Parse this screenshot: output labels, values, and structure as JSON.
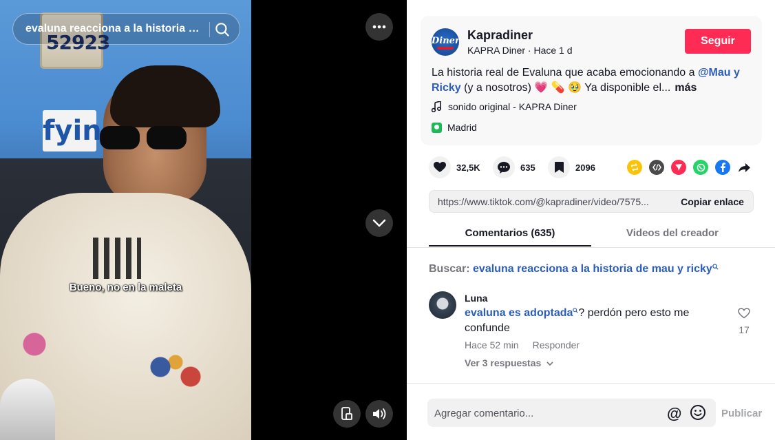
{
  "video": {
    "search_query": "evaluna reacciona a la historia de mau y ricky",
    "subtitle": "Bueno, no en la maleta",
    "plate_text": "52923",
    "logo_text": "fyin",
    "more_icon": "more-horizontal-icon",
    "scroll_down_icon": "chevron-down-icon",
    "pip_icon": "picture-in-picture-icon",
    "volume_icon": "volume-icon"
  },
  "post": {
    "author_name": "Kapradiner",
    "author_sub": "KAPRA Diner · Hace 1 d",
    "avatar_text": "Diner",
    "follow_label": "Seguir",
    "desc_start": "La historia real de Evaluna que acaba emocionando a ",
    "mention": "@Mau y Ricky",
    "desc_end": " (y a nosotros) 💗 💊 🥹  Ya disponible el...",
    "more_label": "más",
    "sound": "sonido original - KAPRA Diner",
    "place": "Madrid"
  },
  "stats": {
    "likes": "32,5K",
    "comments": "635",
    "saves": "2096"
  },
  "share": {
    "link": "https://www.tiktok.com/@kapradiner/video/7575...",
    "copy_label": "Copiar enlace",
    "colors": {
      "repost": "#fcc30b",
      "embed": "#4a4a4a",
      "send": "#fe2c55",
      "whatsapp": "#25d366",
      "facebook": "#1877f2"
    }
  },
  "tabs": {
    "comments": "Comentarios (635)",
    "videos": "Videos del creador"
  },
  "search_related": {
    "prefix": "Buscar: ",
    "term": "evaluna reacciona a la historia de mau y ricky"
  },
  "comment": {
    "user": "Luna",
    "keyword": "evaluna es adoptada",
    "text": "? perdón pero esto me confunde",
    "time": "Hace 52 min",
    "reply_label": "Responder",
    "view_replies": "Ver 3 respuestas",
    "like_count": "17"
  },
  "composer": {
    "placeholder": "Agregar comentario...",
    "mention": "@",
    "publish_label": "Publicar"
  }
}
